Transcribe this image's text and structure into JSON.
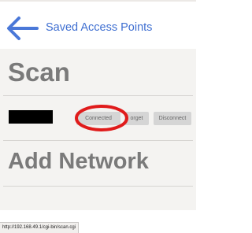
{
  "header": {
    "back_icon": "arrow-left-icon",
    "back_label": "Saved Access Points",
    "accent_color": "#3f6fd1"
  },
  "scan": {
    "title": "Scan",
    "network": {
      "connected_label": "Connected",
      "forget_label": "orget",
      "disconnect_label": "Disconnect"
    },
    "highlight_color": "#e01b1b"
  },
  "add_network": {
    "title": "Add Network"
  },
  "status_bar": {
    "url": "http://192.168.49.1/cgi-bin/scan.cgi"
  }
}
